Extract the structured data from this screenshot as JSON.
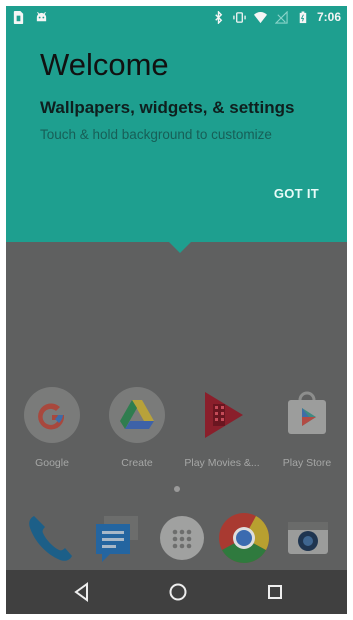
{
  "status_bar": {
    "time": "7:06",
    "left_icons": [
      "sim-card-icon",
      "android-icon"
    ],
    "right_icons": [
      "bluetooth-icon",
      "vibrate-icon",
      "wifi-icon",
      "no-signal-icon",
      "battery-icon"
    ]
  },
  "welcome": {
    "title": "Welcome",
    "subtitle": "Wallpapers, widgets, & settings",
    "body": "Touch & hold background to customize",
    "button_label": "GOT IT",
    "background_color": "#1e9f8f"
  },
  "home_apps": [
    {
      "label": "Google",
      "icon": "google-icon"
    },
    {
      "label": "Create",
      "icon": "drive-create-icon"
    },
    {
      "label": "Play Movies &...",
      "icon": "play-movies-icon"
    },
    {
      "label": "Play Store",
      "icon": "play-store-icon"
    }
  ],
  "dock_apps": [
    {
      "icon": "phone-icon"
    },
    {
      "icon": "messages-icon"
    },
    {
      "icon": "app-drawer-icon"
    },
    {
      "icon": "chrome-icon"
    },
    {
      "icon": "camera-icon"
    }
  ],
  "nav_bar": {
    "buttons": [
      "back-icon",
      "home-icon",
      "recents-icon"
    ]
  }
}
